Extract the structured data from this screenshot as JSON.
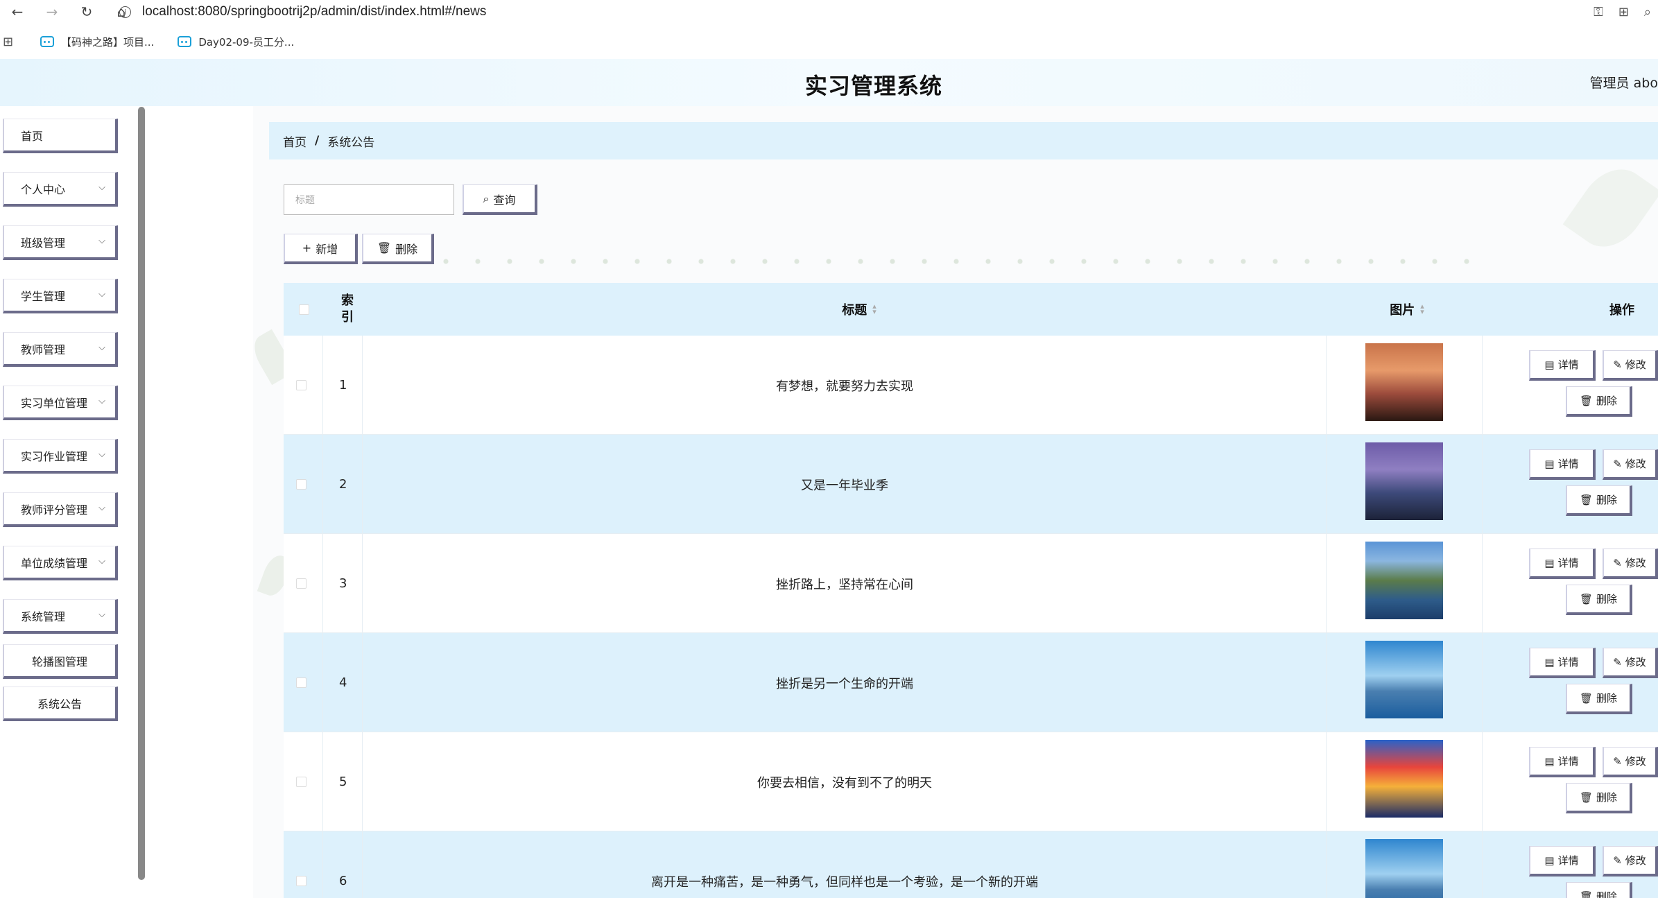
{
  "browser": {
    "url": "localhost:8080/springbootrij2p/admin/dist/index.html#/news",
    "bookmarks": [
      "【码神之路】项目...",
      "Day02-09-员工分..."
    ]
  },
  "header": {
    "title": "实习管理系统",
    "user": "管理员 abo"
  },
  "sidebar": {
    "items": [
      {
        "label": "首页",
        "has_children": false
      },
      {
        "label": "个人中心",
        "has_children": true
      },
      {
        "label": "班级管理",
        "has_children": true
      },
      {
        "label": "学生管理",
        "has_children": true
      },
      {
        "label": "教师管理",
        "has_children": true
      },
      {
        "label": "实习单位管理",
        "has_children": true
      },
      {
        "label": "实习作业管理",
        "has_children": true
      },
      {
        "label": "教师评分管理",
        "has_children": true
      },
      {
        "label": "单位成绩管理",
        "has_children": true
      },
      {
        "label": "系统管理",
        "has_children": true
      },
      {
        "label": "轮播图管理",
        "has_children": false
      },
      {
        "label": "系统公告",
        "has_children": false
      }
    ]
  },
  "breadcrumb": {
    "home": "首页",
    "separator": "/",
    "current": "系统公告"
  },
  "search": {
    "placeholder": "标题",
    "button": "查询"
  },
  "actions": {
    "add": "新增",
    "delete": "删除"
  },
  "table": {
    "columns": {
      "index": "索引",
      "title": "标题",
      "image": "图片",
      "operations": "操作"
    },
    "row_actions": {
      "detail": "详情",
      "edit": "修改",
      "delete": "删除"
    },
    "rows": [
      {
        "index": "1",
        "title": "有梦想，就要努力去实现",
        "image": "girl-balloon-sunset"
      },
      {
        "index": "2",
        "title": "又是一年毕业季",
        "image": "pier-purple-sky"
      },
      {
        "index": "3",
        "title": "挫折路上，坚持常在心间",
        "image": "mountain-lake"
      },
      {
        "index": "4",
        "title": "挫折是另一个生命的开端",
        "image": "lake-tree"
      },
      {
        "index": "5",
        "title": "你要去相信，没有到不了的明天",
        "image": "dolphin-sunset"
      },
      {
        "index": "6",
        "title": "离开是一种痛苦，是一种勇气，但同样也是一个考验，是一个新的开端",
        "image": "lake-tree"
      }
    ]
  },
  "colors": {
    "accent_border": "#6b6b8a",
    "header_bg": "#ddf1fc",
    "even_row_bg": "#ddf1fc"
  }
}
